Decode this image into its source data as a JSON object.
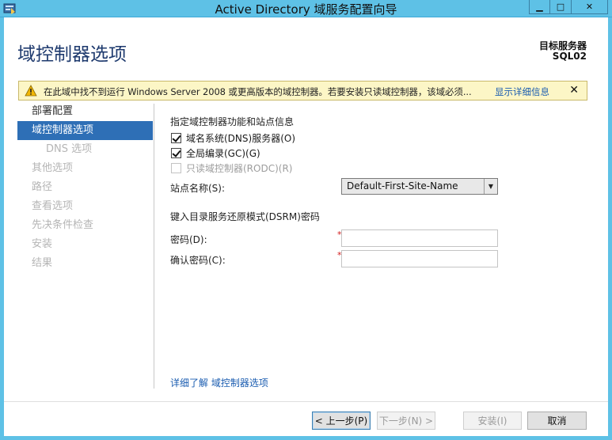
{
  "window": {
    "title": "Active Directory 域服务配置向导",
    "minimize_glyph": "▁",
    "maximize_glyph": "□",
    "close_glyph": "✕"
  },
  "header": {
    "page_title": "域控制器选项",
    "target_label": "目标服务器",
    "target_server": "SQL02"
  },
  "warning": {
    "text": "在此域中找不到运行 Windows Server 2008 或更高版本的域控制器。若要安装只读域控制器，该域必须...",
    "link": "显示详细信息",
    "close_glyph": "✕",
    "icon": "warning-icon",
    "color": "#fcf6c6"
  },
  "sidebar": {
    "items": [
      {
        "label": "部署配置",
        "state": "done"
      },
      {
        "label": "域控制器选项",
        "state": "active"
      },
      {
        "label": "DNS 选项",
        "state": "disabled"
      },
      {
        "label": "其他选项",
        "state": "disabled"
      },
      {
        "label": "路径",
        "state": "disabled"
      },
      {
        "label": "查看选项",
        "state": "disabled"
      },
      {
        "label": "先决条件检查",
        "state": "disabled"
      },
      {
        "label": "安装",
        "state": "disabled"
      },
      {
        "label": "结果",
        "state": "disabled"
      }
    ],
    "active_color": "#2e6fb6"
  },
  "main": {
    "section1": "指定域控制器功能和站点信息",
    "checks": [
      {
        "label": "域名系统(DNS)服务器(O)",
        "checked": true,
        "disabled": false
      },
      {
        "label": "全局编录(GC)(G)",
        "checked": true,
        "disabled": false
      },
      {
        "label": "只读域控制器(RODC)(R)",
        "checked": false,
        "disabled": true
      }
    ],
    "site_label": "站点名称(S):",
    "site_value": "Default-First-Site-Name",
    "section2": "键入目录服务还原模式(DSRM)密码",
    "password_label": "密码(D):",
    "confirm_label": "确认密码(C):",
    "required_mark": "*",
    "password_value": "",
    "confirm_value": "",
    "learn_more": "详细了解 域控制器选项"
  },
  "footer": {
    "prev": "< 上一步(P)",
    "next": "下一步(N) >",
    "install": "安装(I)",
    "cancel": "取消"
  }
}
